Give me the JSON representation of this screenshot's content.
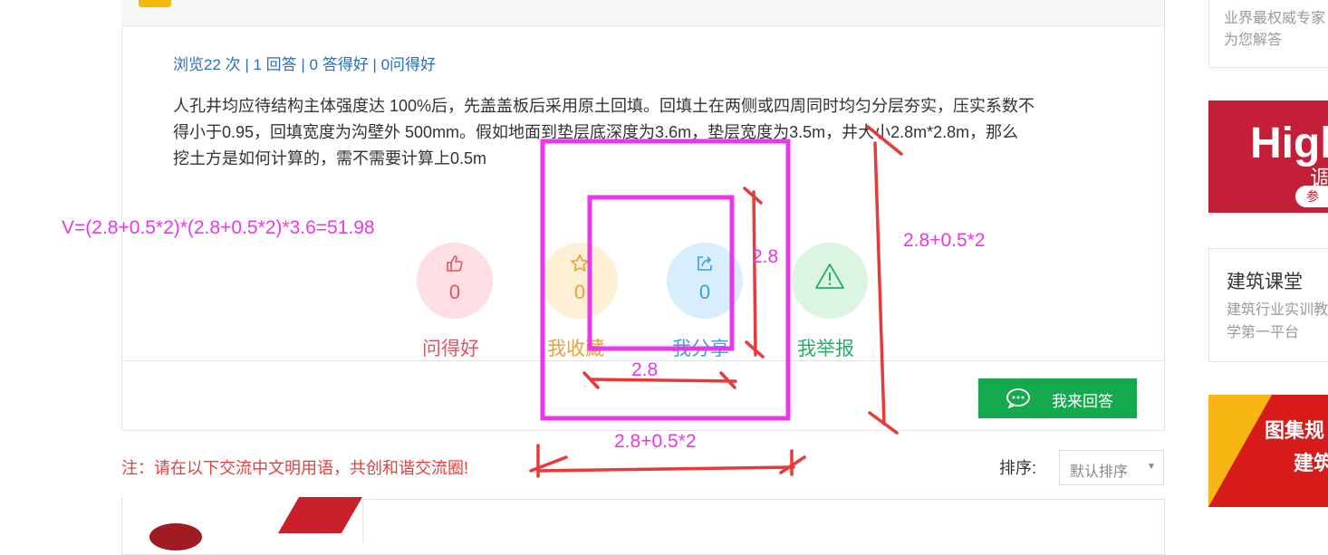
{
  "question": {
    "title": "",
    "stats": "浏览22 次 | 1 回答 | 0 答得好 | 0问得好",
    "body_line1": "人孔井均应待结构主体强度达 100%后，先盖盖板后采用原土回填。回填土在两侧或四周同时均匀分层夯实，压实系数不",
    "body_line2": "得小于0.95，回填宽度为沟壁外 500mm。假如地面到垫层底深度为3.6m，垫层宽度为3.5m，井大小2.8m*2.8m，那么",
    "body_line3": "挖土方是如何计算的，需不需要计算上0.5m"
  },
  "actions": [
    {
      "name": "like",
      "count": "0",
      "label": "问得好",
      "color": "#e15563",
      "bg": "#ffdfe3",
      "icon": "thumbs-up-icon"
    },
    {
      "name": "favorite",
      "count": "0",
      "label": "我收藏",
      "color": "#e6a23c",
      "bg": "#fdf0d5",
      "icon": "star-icon"
    },
    {
      "name": "share",
      "count": "0",
      "label": "我分享",
      "color": "#3a9ddc",
      "bg": "#d9eefc",
      "icon": "share-icon"
    },
    {
      "name": "report",
      "count": "",
      "label": "我举报",
      "color": "#27ae60",
      "bg": "#dcf5e3",
      "icon": "warning-icon"
    }
  ],
  "answer_button": {
    "label": "我来回答",
    "icon": "chat-bubble-icon"
  },
  "notice": "注：请在以下交流中文明用语，共创和谐交流圈!",
  "sort": {
    "label": "排序:",
    "selected": "默认排序"
  },
  "sidebar": {
    "expert_line1": "业界最权威专家",
    "expert_line2": "为您解答",
    "ad1_big": "High",
    "ad1_small": "调",
    "ad1_pill": "参",
    "course_title": "建筑课堂",
    "course_line1": "建筑行业实训教",
    "course_line2": "学第一平台",
    "ad2_line1": "图集规",
    "ad2_line2": "建筑"
  },
  "annotations": {
    "formula": "V=(2.8+0.5*2)*(2.8+0.5*2)*3.6=51.98",
    "inner_side": "2.8",
    "inner_bottom": "2.8",
    "outer_side": "2.8+0.5*2",
    "outer_bottom": "2.8+0.5*2",
    "colors": {
      "magenta": "#e838e8",
      "red": "#e8393b"
    }
  }
}
